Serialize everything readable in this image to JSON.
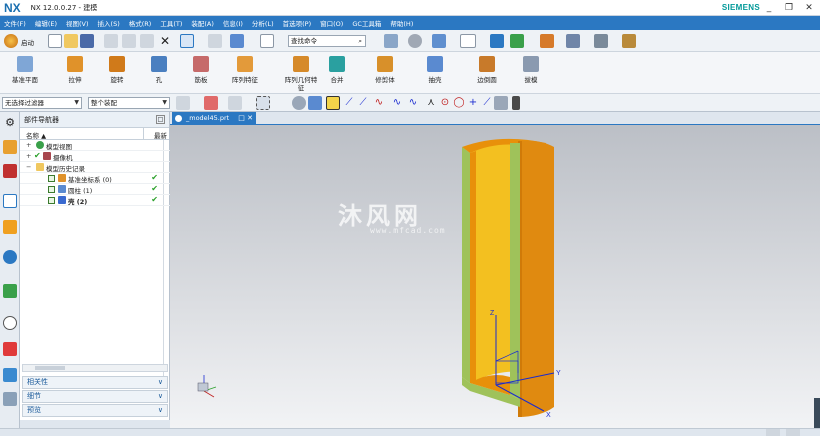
{
  "app": {
    "logo": "NX",
    "title": "NX 12.0.0.27 - 建模",
    "brand": "SIEMENS"
  },
  "window": {
    "minimize": "_",
    "restore": "❐",
    "close": "✕"
  },
  "menu": [
    "文件(F)",
    "编辑(E)",
    "视图(V)",
    "插入(S)",
    "格式(R)",
    "工具(T)",
    "装配(A)",
    "信息(I)",
    "分析(L)",
    "首选项(P)",
    "窗口(O)",
    "GC工具箱",
    "帮助(H)"
  ],
  "toolbar": {
    "start_label": "启动",
    "search_placeholder": "查找命令"
  },
  "ribbon": [
    {
      "label": "基准平面"
    },
    {
      "label": "拉伸"
    },
    {
      "label": "旋转"
    },
    {
      "label": "孔"
    },
    {
      "label": "筋板"
    },
    {
      "label": "阵列特征"
    },
    {
      "label": "阵列几何特",
      "label2": "征"
    },
    {
      "label": "合并"
    },
    {
      "label": "修剪体"
    },
    {
      "label": "抽壳"
    },
    {
      "label": "边倒圆"
    },
    {
      "label": "拔模"
    }
  ],
  "selection": {
    "filter": "无选择过滤器",
    "scope": "整个装配"
  },
  "navigator": {
    "title": "部件导航器",
    "col_name": "名称",
    "col_new": "最新",
    "rows": [
      {
        "label": "模型视图",
        "indent": 0,
        "tick": ""
      },
      {
        "label": "摄像机",
        "indent": 0,
        "tick": "✔"
      },
      {
        "label": "模型历史记录",
        "indent": 0,
        "tick": ""
      },
      {
        "label": "基准坐标系 (0)",
        "indent": 1,
        "tick": "✔"
      },
      {
        "label": "圆柱 (1)",
        "indent": 1,
        "tick": "✔"
      },
      {
        "label": "壳 (2)",
        "indent": 1,
        "tick": "✔"
      }
    ],
    "sections": [
      "相关性",
      "细节",
      "预览"
    ]
  },
  "document": {
    "tab": "_model45.prt"
  },
  "watermark": {
    "main": "沐风网",
    "sub": "www.mfcad.com"
  },
  "axes": {
    "x": "X",
    "y": "Y",
    "z": "Z"
  },
  "colors": {
    "menubar": "#2b78c2",
    "model_orange": "#e8900a",
    "model_inner": "#f3c020",
    "model_green": "#9fc25a",
    "axis_blue": "#1a2bd0"
  }
}
